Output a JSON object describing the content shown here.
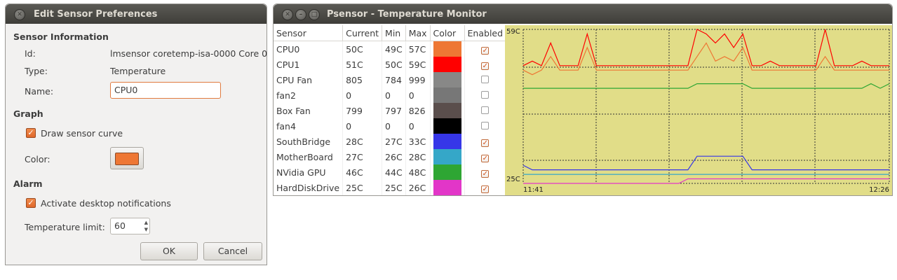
{
  "dialog": {
    "title": "Edit Sensor Preferences",
    "sections": {
      "info": "Sensor Information",
      "graph": "Graph",
      "alarm": "Alarm"
    },
    "info": {
      "id_label": "Id:",
      "id_value": "lmsensor coretemp-isa-0000 Core 0",
      "type_label": "Type:",
      "type_value": "Temperature",
      "name_label": "Name:",
      "name_value": "CPU0"
    },
    "graph": {
      "draw_curve_label": "Draw sensor curve",
      "draw_curve_checked": true,
      "color_label": "Color:",
      "color_value": "#ee7734"
    },
    "alarm": {
      "notifications_label": "Activate desktop notifications",
      "notifications_checked": true,
      "temp_limit_label": "Temperature limit:",
      "temp_limit_value": "60"
    },
    "buttons": {
      "ok": "OK",
      "cancel": "Cancel"
    }
  },
  "psensor": {
    "title": "Psensor - Temperature Monitor",
    "columns": [
      "Sensor",
      "Current",
      "Min",
      "Max",
      "Color",
      "Enabled"
    ],
    "rows": [
      {
        "name": "CPU0",
        "current": "50C",
        "min": "49C",
        "max": "57C",
        "color": "#ee7734",
        "enabled": true
      },
      {
        "name": "CPU1",
        "current": "51C",
        "min": "50C",
        "max": "59C",
        "color": "#ff0000",
        "enabled": true
      },
      {
        "name": "CPU Fan",
        "current": "805",
        "min": "784",
        "max": "999",
        "color": "#888887",
        "enabled": false
      },
      {
        "name": "fan2",
        "current": "0",
        "min": "0",
        "max": "0",
        "color": "#777777",
        "enabled": false
      },
      {
        "name": "Box Fan",
        "current": "799",
        "min": "797",
        "max": "826",
        "color": "#5a4e4c",
        "enabled": false
      },
      {
        "name": "fan4",
        "current": "0",
        "min": "0",
        "max": "0",
        "color": "#000000",
        "enabled": false
      },
      {
        "name": "SouthBridge",
        "current": "28C",
        "min": "27C",
        "max": "33C",
        "color": "#3636e8",
        "enabled": true
      },
      {
        "name": "MotherBoard",
        "current": "27C",
        "min": "26C",
        "max": "28C",
        "color": "#35a7c8",
        "enabled": true
      },
      {
        "name": "NVidia GPU",
        "current": "46C",
        "min": "44C",
        "max": "48C",
        "color": "#2ea633",
        "enabled": true
      },
      {
        "name": "HardDiskDrive",
        "current": "25C",
        "min": "25C",
        "max": "26C",
        "color": "#e236c8",
        "enabled": true
      }
    ],
    "graph": {
      "background": "#e1dd88",
      "y_max_label": "59C",
      "y_min_label": "25C",
      "x_start_label": "11:41",
      "x_end_label": "12:26"
    }
  },
  "chart_data": {
    "type": "line",
    "ylim": [
      25,
      59
    ],
    "x_range": [
      "11:41",
      "12:26"
    ],
    "grid": true,
    "series": [
      {
        "name": "CPU1",
        "color": "#ff0000",
        "values": [
          51,
          52,
          51,
          56,
          51,
          51,
          51,
          58,
          51,
          51,
          51,
          51,
          51,
          51,
          51,
          51,
          51,
          51,
          51,
          59,
          58,
          56,
          58,
          55,
          58,
          51,
          51,
          52,
          51,
          51,
          51,
          51,
          51,
          59,
          51,
          51,
          51,
          52,
          51,
          51,
          51
        ]
      },
      {
        "name": "CPU0",
        "color": "#ee7734",
        "values": [
          50,
          49,
          50,
          53,
          50,
          50,
          50,
          55,
          50,
          50,
          50,
          50,
          50,
          50,
          50,
          50,
          50,
          50,
          50,
          53,
          56,
          52,
          53,
          52,
          55,
          50,
          50,
          50,
          50,
          50,
          50,
          50,
          50,
          53,
          50,
          50,
          50,
          50,
          50,
          50,
          50
        ]
      },
      {
        "name": "NVidia GPU",
        "color": "#2ea633",
        "values": [
          46,
          46,
          46,
          46,
          46,
          46,
          46,
          46,
          46,
          46,
          46,
          46,
          46,
          46,
          46,
          46,
          46,
          46,
          46,
          47,
          47,
          47,
          47,
          47,
          47,
          46,
          46,
          46,
          46,
          46,
          46,
          46,
          46,
          46,
          46,
          46,
          46,
          46,
          47,
          46,
          47
        ]
      },
      {
        "name": "SouthBridge",
        "color": "#3636e8",
        "values": [
          29,
          28,
          28,
          28,
          28,
          28,
          28,
          28,
          28,
          28,
          28,
          28,
          28,
          28,
          28,
          28,
          28,
          28,
          28,
          31,
          31,
          31,
          31,
          31,
          31,
          28,
          28,
          28,
          28,
          28,
          28,
          28,
          28,
          28,
          28,
          28,
          28,
          28,
          28,
          28,
          28
        ]
      },
      {
        "name": "MotherBoard",
        "color": "#35a7c8",
        "values": [
          27,
          27,
          27,
          27,
          27,
          27,
          27,
          27,
          27,
          27,
          27,
          27,
          27,
          27,
          27,
          27,
          27,
          27,
          27,
          27,
          27,
          27,
          27,
          27,
          27,
          27,
          27,
          27,
          27,
          27,
          27,
          27,
          27,
          27,
          27,
          27,
          27,
          27,
          27,
          27,
          27
        ]
      },
      {
        "name": "HardDiskDrive",
        "color": "#e236c8",
        "values": [
          25,
          25,
          25,
          25,
          25,
          25,
          25,
          25,
          25,
          25,
          25,
          25,
          25,
          25,
          25,
          25,
          25,
          25,
          26,
          26,
          26,
          26,
          26,
          26,
          26,
          26,
          26,
          26,
          26,
          26,
          26,
          26,
          26,
          26,
          26,
          26,
          26,
          26,
          26,
          26,
          26
        ]
      }
    ]
  }
}
